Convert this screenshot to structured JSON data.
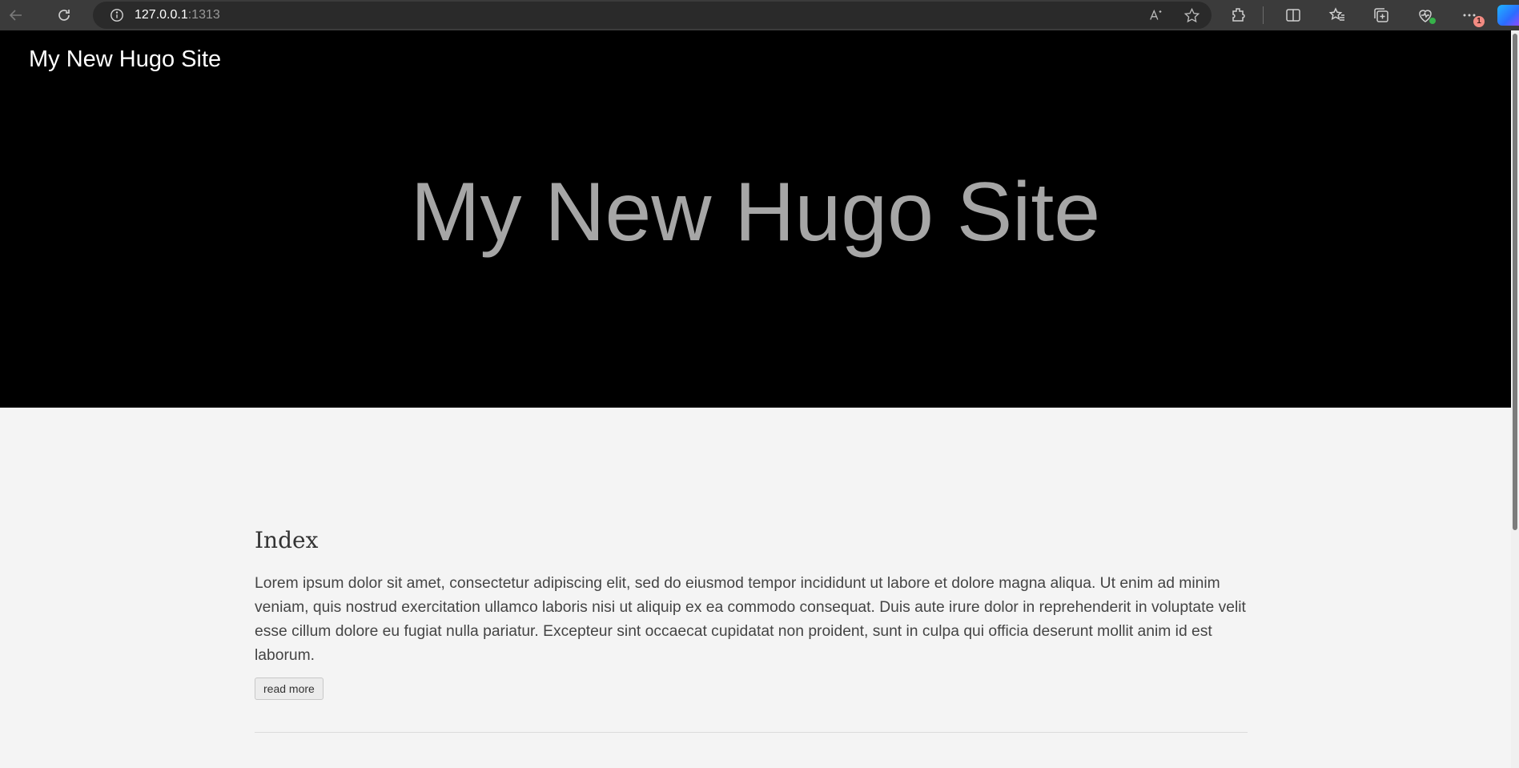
{
  "browser": {
    "url_host": "127.0.0.1",
    "url_port": ":1313"
  },
  "header": {
    "site_title": "My New Hugo Site"
  },
  "hero": {
    "title": "My New Hugo Site"
  },
  "post": {
    "title": "Index",
    "body": "Lorem ipsum dolor sit amet, consectetur adipiscing elit, sed do eiusmod tempor incididunt ut labore et dolore magna aliqua. Ut enim ad minim veniam, quis nostrud exercitation ullamco laboris nisi ut aliquip ex ea commodo consequat. Duis aute irure dolor in reprehenderit in voluptate velit esse cillum dolore eu fugiat nulla pariatur. Excepteur sint occaecat cupidatat non proident, sunt in culpa qui officia deserunt mollit anim id est laborum.",
    "read_more_label": "read more"
  },
  "toolbar": {
    "notification_count": "1"
  },
  "colors": {
    "hero_bg": "#000000",
    "hero_text": "#a6a6a6",
    "page_bg": "#f4f4f4",
    "chrome_bg": "#3b3b3b"
  }
}
